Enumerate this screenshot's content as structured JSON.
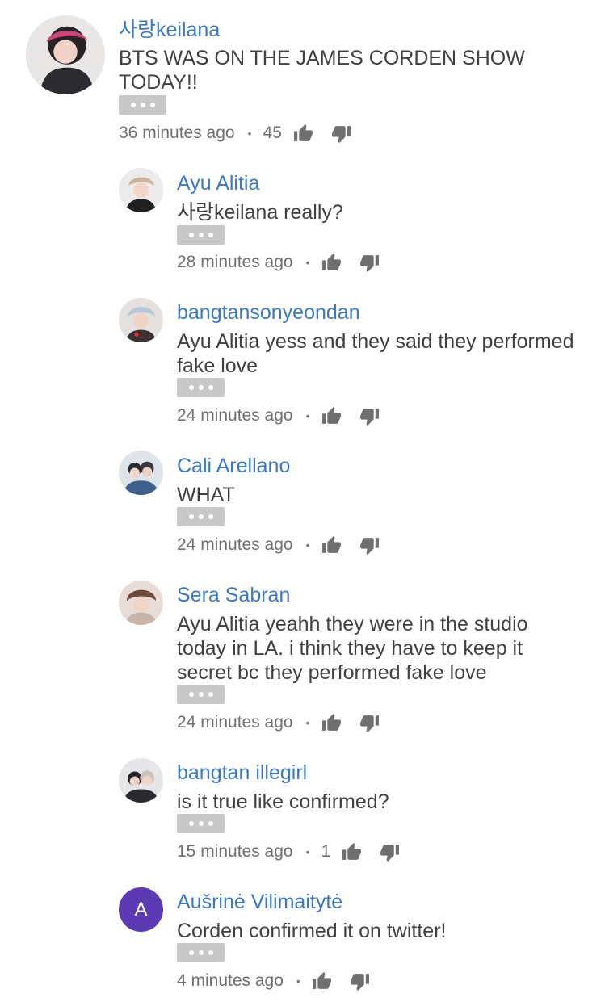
{
  "comments": [
    {
      "author": "사랑keilana",
      "text": "BTS WAS ON THE JAMES CORDEN SHOW TODAY!!",
      "time": "36 minutes ago",
      "likes": "45",
      "avatar_icon": "user-photo-icon"
    },
    {
      "author": "Ayu Alitia",
      "text": "사랑keilana really?",
      "time": "28 minutes ago",
      "likes": "",
      "avatar_icon": "user-photo-icon"
    },
    {
      "author": "bangtansonyeondan",
      "text": "Ayu Alitia yess and they said they performed fake love",
      "time": "24 minutes ago",
      "likes": "",
      "avatar_icon": "user-photo-icon"
    },
    {
      "author": "Cali Arellano",
      "text": "WHAT",
      "time": "24 minutes ago",
      "likes": "",
      "avatar_icon": "user-photo-icon"
    },
    {
      "author": "Sera Sabran",
      "text": "Ayu Alitia yeahh they were in the studio today in LA. i think they have to keep it secret bc they performed fake love",
      "time": "24 minutes ago",
      "likes": "",
      "avatar_icon": "user-photo-icon"
    },
    {
      "author": "bangtan illegirl",
      "text": "is it true like confirmed?",
      "time": "15 minutes ago",
      "likes": "1",
      "avatar_icon": "user-photo-icon"
    },
    {
      "author": "Aušrinė Vilimaitytė",
      "text": "Corden confirmed it on twitter!",
      "time": "4 minutes ago",
      "likes": "",
      "avatar_letter": "A",
      "avatar_color": "#5b3ab3"
    }
  ],
  "meta_separator": "•",
  "colors": {
    "author": "#3c78c8",
    "text": "#404040",
    "meta": "#6f6f6f",
    "more_button": "#c8c8c8"
  },
  "icons": {
    "like": "thumbs-up-icon",
    "dislike": "thumbs-down-icon",
    "more": "more-options-icon"
  }
}
